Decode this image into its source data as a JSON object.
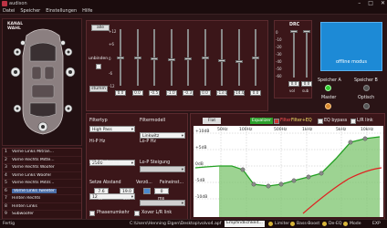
{
  "window": {
    "title": "audison"
  },
  "menu": [
    "Datei",
    "Speicher",
    "Einstellungen",
    "Hilfe"
  ],
  "car": {
    "kanal_line1": "KANAL",
    "kanal_line2": "WAHL"
  },
  "channels": [
    {
      "num": "1",
      "name": "Vorne Links Mitran..."
    },
    {
      "num": "2",
      "name": "Vorne Rechts Mitte..."
    },
    {
      "num": "3",
      "name": "Vorne Rechts Woofer"
    },
    {
      "num": "4",
      "name": "Vorne Links Woofer"
    },
    {
      "num": "5",
      "name": "Vorne Rechts Mitdr..."
    },
    {
      "num": "6",
      "name": "Vorne Links Tweeter"
    },
    {
      "num": "7",
      "name": "Hinten Rechts"
    },
    {
      "num": "8",
      "name": "Hinten Links"
    },
    {
      "num": "9",
      "name": "Subwoofer"
    }
  ],
  "geq": {
    "alle_label": "alle",
    "unbinden_label": "unbinden",
    "stumm_label": "stumm",
    "db_labels": [
      "+12",
      "+6",
      "0",
      "-6",
      "-12"
    ],
    "values": [
      "0.0",
      "0.0",
      "-0.5",
      "-1.0",
      "-0.3",
      "0.0",
      "-13.0",
      "-14.0",
      "0.0"
    ],
    "knob_levels": [
      0.5,
      0.5,
      0.52,
      0.54,
      0.51,
      0.5,
      0.55,
      0.56,
      0.5
    ]
  },
  "drc": {
    "title": "DRC",
    "db_labels": [
      "0",
      "-10",
      "-20",
      "-30",
      "-40",
      "-50",
      "-60"
    ],
    "values": [
      "0.0",
      "0.0"
    ],
    "knob_levels": [
      0.0,
      0.0
    ],
    "units": [
      "vol",
      "sub"
    ]
  },
  "offline": {
    "label": "offline modus"
  },
  "speaker": {
    "a_label": "Speicher A",
    "b_label": "Speicher B",
    "master_label": "Master",
    "optisch_label": "Optisch"
  },
  "filter": {
    "filtertyp_label": "Filtertyp",
    "filtertyp_value": "High Pass",
    "filtermodell_label": "Filtermodell",
    "filtermodell_value": "Linkwitz",
    "hipf_label": "Hi-P Hz",
    "hipf_value": "2500",
    "lopf_label": "Lo-P Hz",
    "hipslope_label": "Hi-P Steigung",
    "hipslope_value": "12",
    "lopslope_label": "Lo-P Steigung",
    "setze_label": "Setze Abstand",
    "setze_value": "7.6",
    "setze_unit": "in",
    "verz_label": "Verzö...",
    "verz_value": "19.0",
    "verz_unit": "cm",
    "fein_label": "Feineinst...",
    "fein_value": "0",
    "fein_unit": "ms",
    "phase_label": "Phasenumkehr",
    "xover_label": "Xover L/R link"
  },
  "graph": {
    "flat_label": "Flat",
    "eq_badge": "Equalizer",
    "filter_label": "Filter",
    "filter_eq_label": "Filter+EQ",
    "bypass_label": "EQ bypass",
    "lrlink_label": "L/R link",
    "y_labels": [
      "+10dB",
      "+5dB",
      "0dB",
      "-5dB",
      "-10dB"
    ],
    "x_labels": [
      "50Hz",
      "100Hz",
      "500Hz",
      "1kHz",
      "5kHz",
      "10kHz"
    ]
  },
  "status": {
    "left": "Fertig",
    "path": "C:\\Users\\Henning Elgen\\Desktop\\volvo4.apf",
    "field": "Empfindlichkeit...",
    "limiter": "Limiter",
    "bassboost": "Bass-Boost",
    "deeq": "De-EQ",
    "mode": "Mode",
    "exp": "EXP"
  }
}
